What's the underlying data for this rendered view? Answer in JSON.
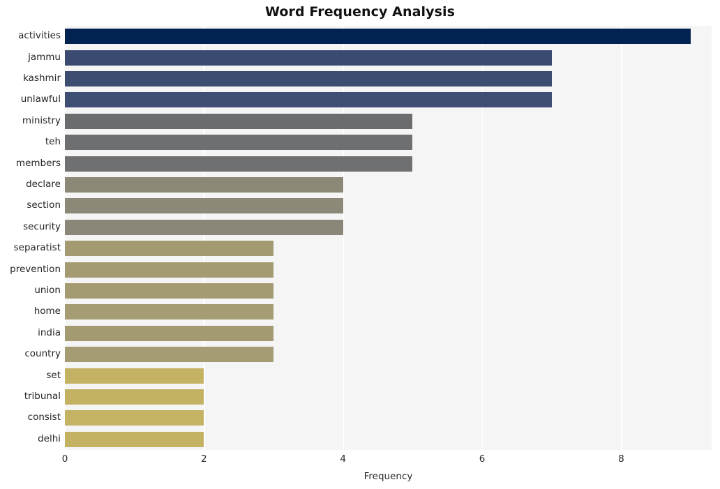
{
  "chart_data": {
    "type": "bar",
    "orientation": "horizontal",
    "title": "Word Frequency Analysis",
    "xlabel": "Frequency",
    "ylabel": "",
    "xlim": [
      0,
      9.3
    ],
    "ylim": null,
    "grid": true,
    "legend": null,
    "xticks": [
      "0",
      "2",
      "4",
      "6",
      "8"
    ],
    "xtick_values": [
      0,
      2,
      4,
      6,
      8
    ],
    "categories": [
      "activities",
      "jammu",
      "kashmir",
      "unlawful",
      "ministry",
      "teh",
      "members",
      "declare",
      "section",
      "security",
      "separatist",
      "prevention",
      "union",
      "home",
      "india",
      "country",
      "set",
      "tribunal",
      "consist",
      "delhi"
    ],
    "values": [
      9,
      7,
      7,
      7,
      5,
      5,
      5,
      4,
      4,
      4,
      3,
      3,
      3,
      3,
      3,
      3,
      2,
      2,
      2,
      2
    ],
    "bar_colors": [
      "#022251",
      "#3a4a70",
      "#3d4d72",
      "#3f4f74",
      "#6b6c6e",
      "#6e6f70",
      "#6f7072",
      "#8b8878",
      "#8c8979",
      "#8a8778",
      "#a39a72",
      "#a49b73",
      "#a49b72",
      "#a59c73",
      "#a39a71",
      "#a59c74",
      "#c4b263",
      "#c4b264",
      "#c5b365",
      "#c4b263"
    ],
    "plot_background": "#f5f5f5",
    "gridline_color": "#ffffff",
    "figure_background": "#ffffff",
    "text_color": "#262626"
  }
}
